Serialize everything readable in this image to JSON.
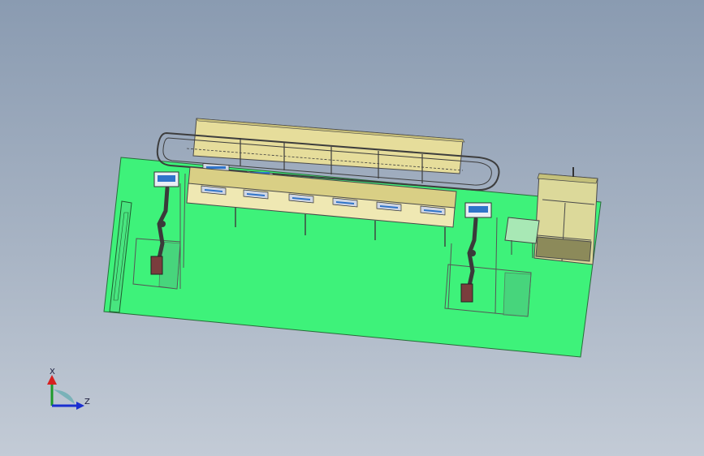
{
  "viewport": {
    "background_top": "#8a9bb1",
    "background_bottom": "#c3cbd6"
  },
  "model": {
    "floor_color": "#3ef27a",
    "tan_color": "#e6dd9b",
    "frame_color": "#4a4a4a",
    "screen_color": "#2f74c9",
    "robot_color": "#3a3a3a",
    "fixture_color": "#7a3d3d",
    "enclosure_color": "#dcd99a"
  },
  "triad": {
    "x_label": "X",
    "z_label": "Z",
    "x_color": "#d62020",
    "y_color": "#1e9a2a",
    "z_color": "#1a2fd0"
  }
}
